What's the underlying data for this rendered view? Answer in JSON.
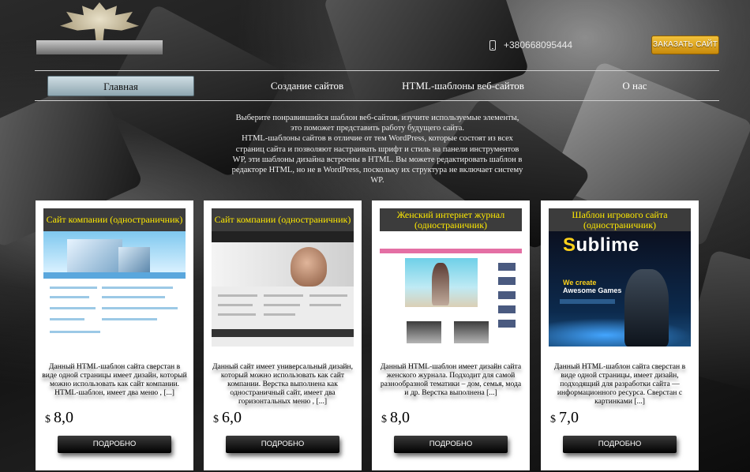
{
  "header": {
    "phone": "+380668095444",
    "order_button": "ЗАКАЗАТЬ САЙТ"
  },
  "nav": {
    "items": [
      {
        "label": "Главная",
        "active": true
      },
      {
        "label": "Создание сайтов",
        "active": false
      },
      {
        "label": "HTML-шаблоны веб-сайтов",
        "active": false
      },
      {
        "label": "О нас",
        "active": false
      }
    ]
  },
  "intro": {
    "lines": [
      "Выберите понравившийся шаблон веб-сайтов, изучите используемые элементы,",
      "это поможет представить работу будущего сайта.",
      "HTML-шаблоны сайтов в отличие от тем WordPress, которые состоят из всех",
      "страниц сайта и позволяют настраивать шрифт и стиль на панели инструментов",
      "WP, эти шаблоны дизайна встроены в HTML. Вы можете редактировать шаблон в",
      "редакторе HTML, но не в WordPress, поскольку их структура не включает систему",
      "WP."
    ]
  },
  "cards": [
    {
      "title": "Сайт компании (одностраничник)",
      "description": "Данный HTML-шаблон сайта сверстан в виде одной страницы имеет дизайн, который можно использовать как сайт компании. HTML-шаблон, имеет два меню , [...]",
      "currency": "$",
      "price": "8,0",
      "button": "ПОДРОБНО",
      "thumb": "company-site"
    },
    {
      "title": "Сайт компании (одностраничник)",
      "description": "Данный сайт имеет универсальный дизайн, который можно использовать как сайт компании. Верстка выполнена как одностраничный сайт, имеет два горизонтальных меню , [...]",
      "currency": "$",
      "price": "6,0",
      "button": "ПОДРОБНО",
      "thumb": "business-site"
    },
    {
      "title": "Женский интернет журнал (одностраничник)",
      "description": "Данный HTML-шаблон имеет дизайн сайта женского журнала. Подходит для самой разнообразной тематики – дом, семья, мода и др. Верстка выполнена [...]",
      "currency": "$",
      "price": "8,0",
      "button": "ПОДРОБНО",
      "thumb": "women-magazine"
    },
    {
      "title": "Шаблон игрового сайта (одностраничник)",
      "description": "Данный HTML-шаблон сайта сверстан в виде одной страницы, имеет дизайн, подходящий для разработки сайта — информационного ресурса. Сверстан с картинками [...]",
      "currency": "$",
      "price": "7,0",
      "button": "ПОДРОБНО",
      "thumb": "game-site",
      "thumb_text": {
        "brand_first": "S",
        "brand_rest": "ublime",
        "tag_line_1": "We create",
        "tag_line_2": "Awesome Games"
      }
    }
  ],
  "colors": {
    "card_title_text": "#ffea00",
    "card_title_bg": "#3c3c3c",
    "order_button": "#e0a521",
    "nav_active": "#b4c6cd"
  }
}
